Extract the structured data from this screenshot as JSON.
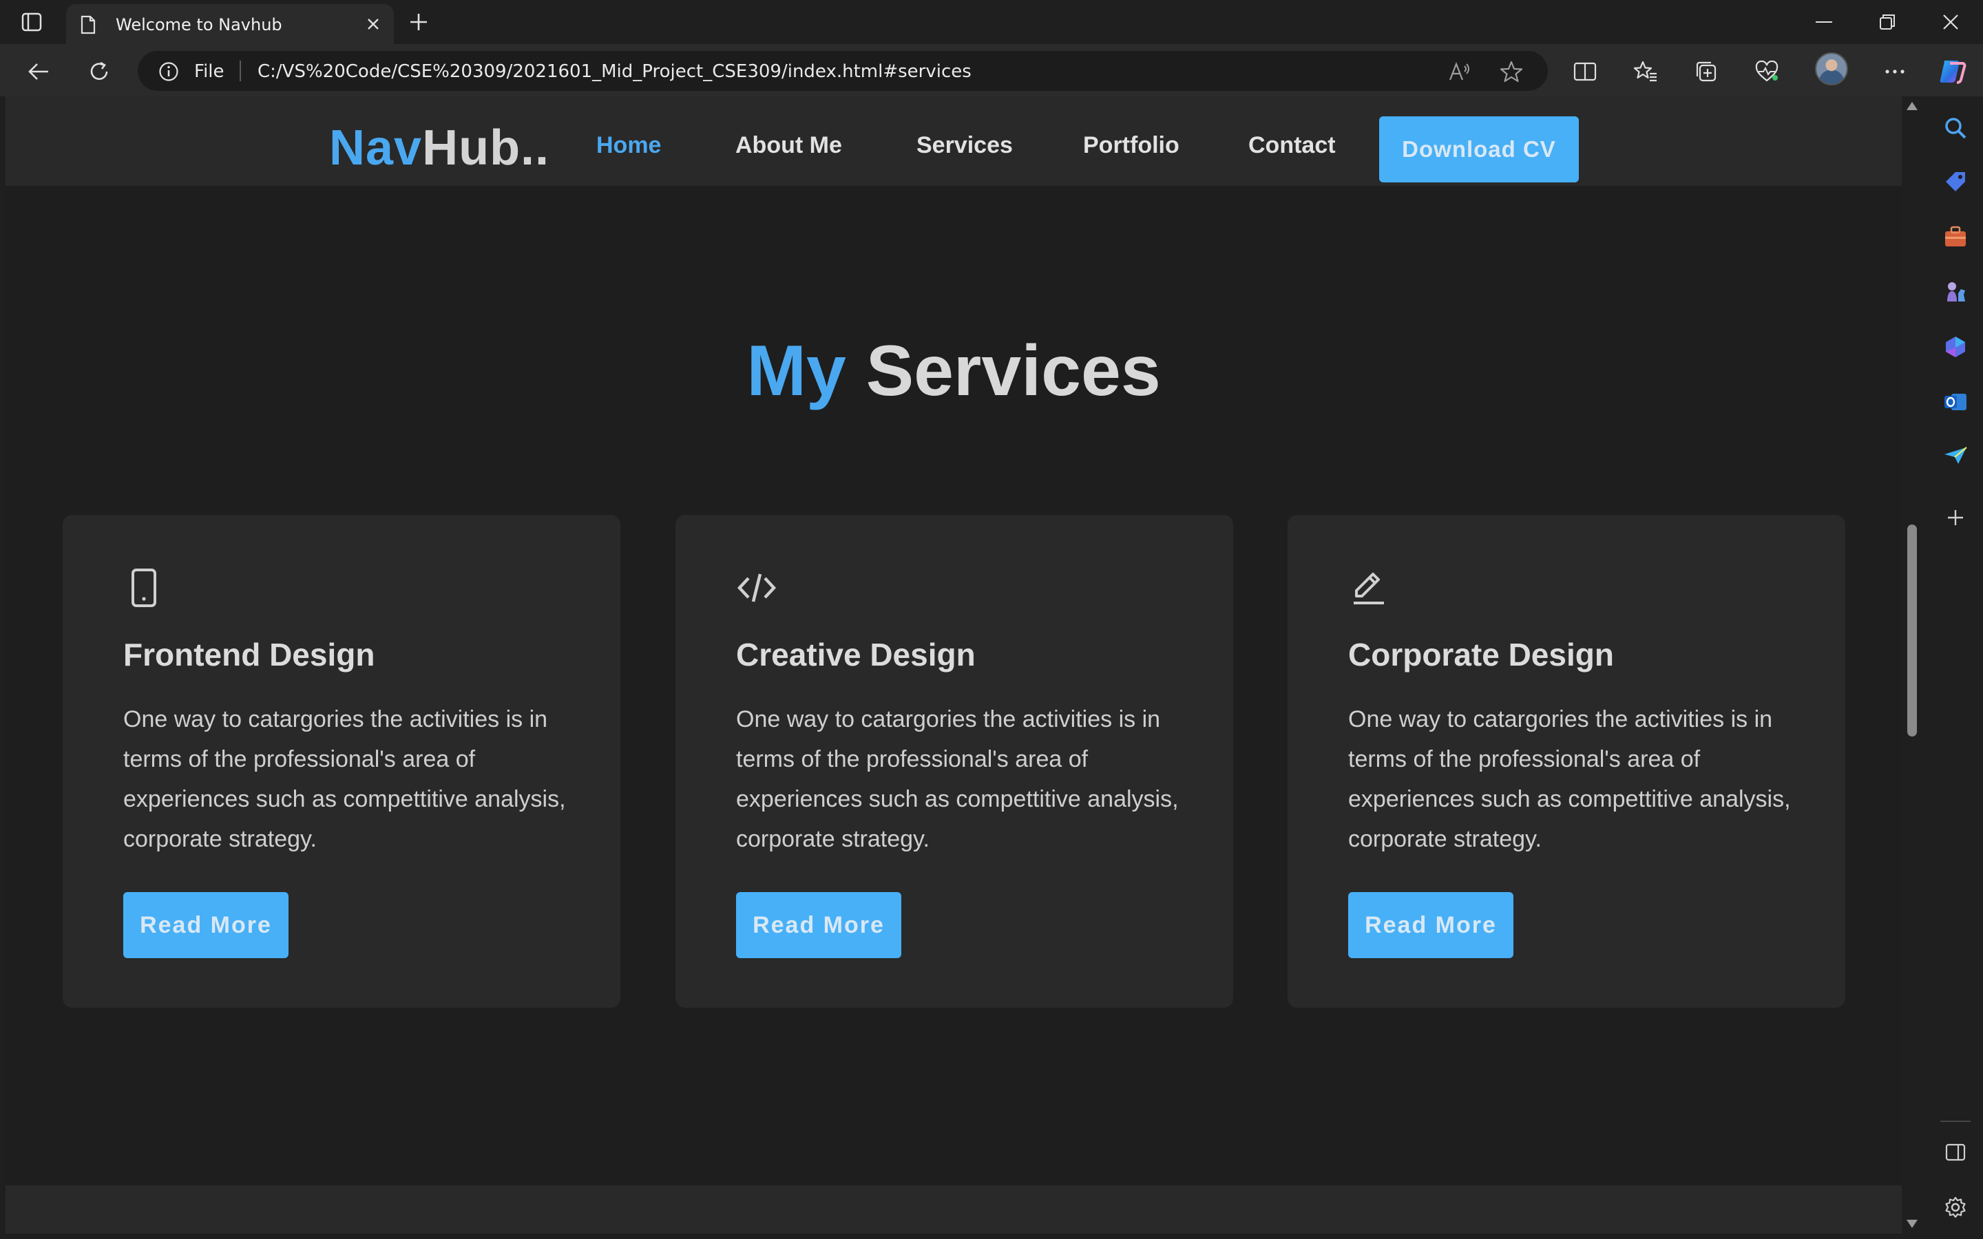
{
  "browser": {
    "tab": {
      "title": "Welcome to Navhub"
    },
    "address": {
      "site_label": "File",
      "url": "C:/VS%20Code/CSE%20309/2021601_Mid_Project_CSE309/index.html#services"
    }
  },
  "site": {
    "logo": {
      "part1": "Nav",
      "part2": "Hub.."
    },
    "nav": {
      "home": "Home",
      "about": "About Me",
      "services": "Services",
      "portfolio": "Portfolio",
      "contact": "Contact"
    },
    "cv_button": "Download CV"
  },
  "services": {
    "title_accent": "My",
    "title_rest": "Services",
    "cards": [
      {
        "icon": "tablet-icon",
        "title": "Frontend Design",
        "text": "One way to catargories the activities is in terms of the professional's area of experiences such as compettitive analysis, corporate strategy.",
        "button": "Read More"
      },
      {
        "icon": "code-icon",
        "title": "Creative Design",
        "text": "One way to catargories the activities is in terms of the professional's area of experiences such as compettitive analysis, corporate strategy.",
        "button": "Read More"
      },
      {
        "icon": "pen-icon",
        "title": "Corporate Design",
        "text": "One way to catargories the activities is in terms of the professional's area of experiences such as compettitive analysis, corporate strategy.",
        "button": "Read More"
      }
    ]
  },
  "colors": {
    "accent": "#4aa8f0",
    "button": "#47b0f7",
    "page_bg": "#1e1e1e",
    "card_bg": "#292929"
  }
}
